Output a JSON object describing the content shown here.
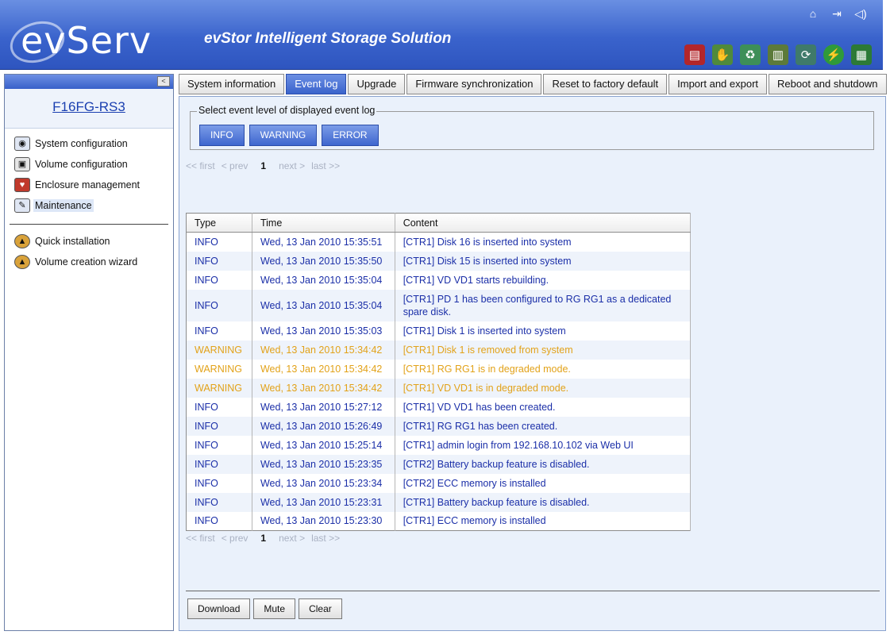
{
  "header": {
    "logo": "evServ",
    "subtitle": "evStor Intelligent Storage Solution",
    "top_icons": [
      "home-icon",
      "logout-icon",
      "sound-icon"
    ],
    "tool_icons": [
      "disk-warning-icon",
      "hand-ok-icon",
      "recycle-icon",
      "server-icon",
      "refresh-icon",
      "power-icon",
      "board-icon"
    ]
  },
  "sidebar": {
    "collapse_symbol": "<",
    "device_name": "F16FG-RS3",
    "items": [
      {
        "label": "System configuration"
      },
      {
        "label": "Volume configuration"
      },
      {
        "label": "Enclosure management"
      },
      {
        "label": "Maintenance"
      }
    ],
    "wizards": [
      {
        "label": "Quick installation"
      },
      {
        "label": "Volume creation wizard"
      }
    ]
  },
  "tabs": [
    {
      "label": "System information"
    },
    {
      "label": "Event log"
    },
    {
      "label": "Upgrade"
    },
    {
      "label": "Firmware synchronization"
    },
    {
      "label": "Reset to factory default"
    },
    {
      "label": "Import and export"
    },
    {
      "label": "Reboot and shutdown"
    }
  ],
  "filter": {
    "legend": "Select event level of displayed event log",
    "levels": [
      "INFO",
      "WARNING",
      "ERROR"
    ]
  },
  "pager": {
    "first": "<< first",
    "prev": "< prev",
    "current": "1",
    "next": "next >",
    "last": "last >>"
  },
  "table": {
    "headers": [
      "Type",
      "Time",
      "Content"
    ],
    "rows": [
      {
        "type": "INFO",
        "time": "Wed, 13 Jan 2010 15:35:51",
        "content": "[CTR1] Disk 16 is inserted into system"
      },
      {
        "type": "INFO",
        "time": "Wed, 13 Jan 2010 15:35:50",
        "content": "[CTR1] Disk 15 is inserted into system"
      },
      {
        "type": "INFO",
        "time": "Wed, 13 Jan 2010 15:35:04",
        "content": "[CTR1] VD VD1 starts rebuilding."
      },
      {
        "type": "INFO",
        "time": "Wed, 13 Jan 2010 15:35:04",
        "content": "[CTR1] PD 1 has been configured to RG RG1 as a dedicated spare disk."
      },
      {
        "type": "INFO",
        "time": "Wed, 13 Jan 2010 15:35:03",
        "content": "[CTR1] Disk 1 is inserted into system"
      },
      {
        "type": "WARNING",
        "time": "Wed, 13 Jan 2010 15:34:42",
        "content": "[CTR1] Disk 1 is removed from system"
      },
      {
        "type": "WARNING",
        "time": "Wed, 13 Jan 2010 15:34:42",
        "content": "[CTR1] RG RG1 is in degraded mode."
      },
      {
        "type": "WARNING",
        "time": "Wed, 13 Jan 2010 15:34:42",
        "content": "[CTR1] VD VD1 is in degraded mode."
      },
      {
        "type": "INFO",
        "time": "Wed, 13 Jan 2010 15:27:12",
        "content": "[CTR1] VD VD1 has been created."
      },
      {
        "type": "INFO",
        "time": "Wed, 13 Jan 2010 15:26:49",
        "content": "[CTR1] RG RG1 has been created."
      },
      {
        "type": "INFO",
        "time": "Wed, 13 Jan 2010 15:25:14",
        "content": "[CTR1] admin login from 192.168.10.102 via Web UI"
      },
      {
        "type": "INFO",
        "time": "Wed, 13 Jan 2010 15:23:35",
        "content": "[CTR2] Battery backup feature is disabled."
      },
      {
        "type": "INFO",
        "time": "Wed, 13 Jan 2010 15:23:34",
        "content": "[CTR2] ECC memory is installed"
      },
      {
        "type": "INFO",
        "time": "Wed, 13 Jan 2010 15:23:31",
        "content": "[CTR1] Battery backup feature is disabled."
      },
      {
        "type": "INFO",
        "time": "Wed, 13 Jan 2010 15:23:30",
        "content": "[CTR1] ECC memory is installed"
      }
    ]
  },
  "buttons": {
    "download": "Download",
    "mute": "Mute",
    "clear": "Clear"
  },
  "colors": {
    "info": "#1b2fa8",
    "warning": "#e2a219",
    "accent": "#3a63cc"
  }
}
